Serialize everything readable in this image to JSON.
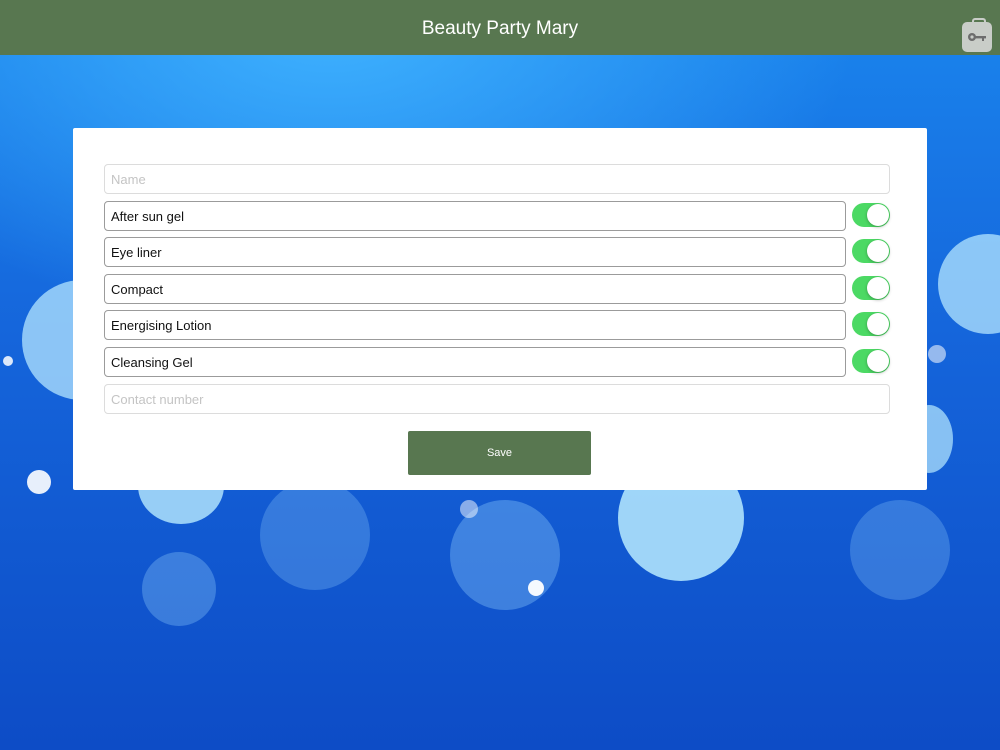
{
  "nav": {
    "title": "Beauty Party Mary",
    "action_icon": "briefcase-key-icon"
  },
  "form": {
    "name_placeholder": "Name",
    "contact_placeholder": "Contact number",
    "items": [
      {
        "label": "After sun gel",
        "enabled": true
      },
      {
        "label": "Eye liner",
        "enabled": true
      },
      {
        "label": "Compact",
        "enabled": true
      },
      {
        "label": "Energising Lotion",
        "enabled": true
      },
      {
        "label": "Cleansing Gel",
        "enabled": true
      }
    ],
    "save_label": "Save"
  },
  "colors": {
    "primary": "#587750",
    "toggle_on": "#4cd964",
    "background": "#1565db"
  }
}
